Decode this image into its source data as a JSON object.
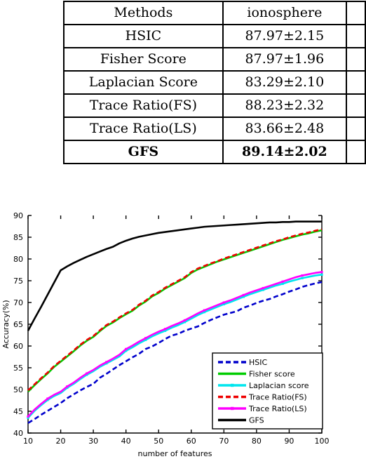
{
  "table": {
    "name": "results-table",
    "columns": [
      "Methods",
      "ionosphere",
      ""
    ],
    "rows": [
      {
        "method": "Methods",
        "value": "ionosphere",
        "extra": "",
        "header": true
      },
      {
        "method": "HSIC",
        "value": "87.97±2.15",
        "extra": ""
      },
      {
        "method": "Fisher Score",
        "value": "87.97±1.96",
        "extra": ""
      },
      {
        "method": "Laplacian Score",
        "value": "83.29±2.10",
        "extra": ""
      },
      {
        "method": "Trace Ratio(FS)",
        "value": "88.23±2.32",
        "extra": ""
      },
      {
        "method": "Trace Ratio(LS)",
        "value": "83.66±2.48",
        "extra": ""
      },
      {
        "method": "GFS",
        "value": "89.14±2.02",
        "extra": "",
        "bold": true
      }
    ]
  },
  "chart_data": {
    "type": "line",
    "title": "",
    "xlabel": "number of features",
    "ylabel": "Accuracy(%)",
    "xlim": [
      10,
      100
    ],
    "ylim": [
      40,
      90
    ],
    "xticks": [
      10,
      20,
      30,
      40,
      50,
      60,
      70,
      80,
      90,
      100
    ],
    "yticks": [
      40,
      45,
      50,
      55,
      60,
      65,
      70,
      75,
      80,
      85,
      90
    ],
    "grid": false,
    "legend_position": "lower-right",
    "x": [
      10,
      12,
      14,
      16,
      18,
      20,
      22,
      24,
      26,
      28,
      30,
      32,
      34,
      36,
      38,
      40,
      42,
      44,
      46,
      48,
      50,
      52,
      54,
      56,
      58,
      60,
      62,
      64,
      66,
      68,
      70,
      72,
      74,
      76,
      78,
      80,
      82,
      84,
      86,
      88,
      90,
      92,
      94,
      96,
      98,
      100
    ],
    "series": [
      {
        "name": "HSIC",
        "color": "#0000cc",
        "style": "dashed",
        "marker": "none",
        "values": [
          42.3,
          43.2,
          44.2,
          45.1,
          46.0,
          46.9,
          48.0,
          48.9,
          49.8,
          50.6,
          51.3,
          52.7,
          53.6,
          54.6,
          55.6,
          56.5,
          57.4,
          58.2,
          59.3,
          59.9,
          60.7,
          61.6,
          62.4,
          62.8,
          63.5,
          64.0,
          64.5,
          65.3,
          66.0,
          66.6,
          67.2,
          67.6,
          68.0,
          68.8,
          69.3,
          69.9,
          70.4,
          70.8,
          71.4,
          71.9,
          72.5,
          73.0,
          73.6,
          74.0,
          74.4,
          74.7
        ]
      },
      {
        "name": "Fisher score",
        "color": "#00cc00",
        "style": "solid",
        "marker": "none",
        "values": [
          49.5,
          51.0,
          52.4,
          53.7,
          55.2,
          56.4,
          57.6,
          58.8,
          60.1,
          61.2,
          62.1,
          63.4,
          64.6,
          65.4,
          66.4,
          67.3,
          68.1,
          69.3,
          70.2,
          71.4,
          72.2,
          73.2,
          74.0,
          74.8,
          75.6,
          76.8,
          77.6,
          78.2,
          78.8,
          79.4,
          79.9,
          80.4,
          80.9,
          81.4,
          81.9,
          82.4,
          82.9,
          83.4,
          83.9,
          84.4,
          84.8,
          85.2,
          85.6,
          85.9,
          86.3,
          86.6
        ]
      },
      {
        "name": "Laplacian score",
        "color": "#00e5ee",
        "style": "solid",
        "marker": "dot",
        "values": [
          43.5,
          45.1,
          46.4,
          47.6,
          48.5,
          49.2,
          50.4,
          51.3,
          52.4,
          53.4,
          54.2,
          55.2,
          56.0,
          56.8,
          57.6,
          58.9,
          59.7,
          60.6,
          61.4,
          62.2,
          62.9,
          63.5,
          64.2,
          64.8,
          65.5,
          66.3,
          67.1,
          67.8,
          68.4,
          69.0,
          69.6,
          70.1,
          70.7,
          71.3,
          71.9,
          72.4,
          72.9,
          73.4,
          73.9,
          74.3,
          74.8,
          75.2,
          75.6,
          75.9,
          76.2,
          76.4
        ]
      },
      {
        "name": "Trace Ratio(FS)",
        "color": "#ee0000",
        "style": "dashed",
        "marker": "none",
        "values": [
          49.8,
          51.2,
          52.6,
          53.9,
          55.4,
          56.6,
          57.8,
          59.0,
          60.3,
          61.4,
          62.3,
          63.6,
          64.8,
          65.6,
          66.6,
          67.5,
          68.3,
          69.5,
          70.4,
          71.6,
          72.4,
          73.4,
          74.2,
          75.0,
          75.8,
          77.0,
          77.8,
          78.4,
          79.0,
          79.5,
          80.1,
          80.6,
          81.1,
          81.6,
          82.1,
          82.6,
          83.1,
          83.6,
          84.1,
          84.5,
          85.0,
          85.4,
          85.8,
          86.1,
          86.5,
          86.8
        ]
      },
      {
        "name": "Trace Ratio(LS)",
        "color": "#ff00ff",
        "style": "solid",
        "marker": "dot",
        "values": [
          43.8,
          45.4,
          46.7,
          47.9,
          48.8,
          49.5,
          50.7,
          51.6,
          52.7,
          53.7,
          54.5,
          55.5,
          56.3,
          57.1,
          58.0,
          59.3,
          60.1,
          61.0,
          61.8,
          62.6,
          63.3,
          63.9,
          64.6,
          65.2,
          65.9,
          66.7,
          67.5,
          68.2,
          68.8,
          69.4,
          70.0,
          70.5,
          71.1,
          71.7,
          72.3,
          72.8,
          73.3,
          73.8,
          74.3,
          74.8,
          75.3,
          75.8,
          76.2,
          76.5,
          76.8,
          77.0
        ]
      },
      {
        "name": "GFS",
        "color": "#000000",
        "style": "solid",
        "marker": "none",
        "values": [
          63.5,
          66.3,
          69.0,
          71.8,
          74.6,
          77.4,
          78.3,
          79.1,
          79.8,
          80.5,
          81.1,
          81.7,
          82.3,
          82.8,
          83.6,
          84.2,
          84.7,
          85.1,
          85.4,
          85.7,
          86.0,
          86.2,
          86.4,
          86.6,
          86.8,
          87.0,
          87.2,
          87.4,
          87.5,
          87.6,
          87.7,
          87.8,
          87.9,
          88.0,
          88.1,
          88.2,
          88.3,
          88.4,
          88.4,
          88.5,
          88.5,
          88.6,
          88.6,
          88.6,
          88.6,
          88.6
        ]
      }
    ]
  }
}
